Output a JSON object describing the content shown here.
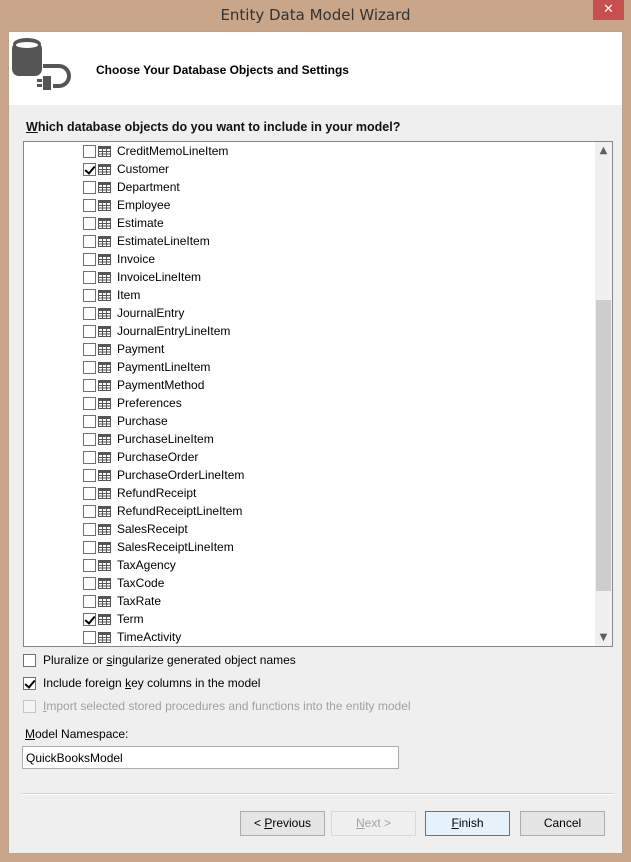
{
  "window": {
    "title": "Entity Data Model Wizard",
    "close_glyph": "✕"
  },
  "header": {
    "icon": "database-plug-icon",
    "title": "Choose Your Database Objects and Settings"
  },
  "question": {
    "mnemonic": "W",
    "rest": "hich database objects do you want to include in your model?"
  },
  "object_list": {
    "item_icon": "table-icon",
    "scroll_position": {
      "thumb_start_fraction": 0.3,
      "thumb_end_fraction": 0.92
    },
    "items": [
      {
        "label": "CreditMemoLineItem",
        "checked": false
      },
      {
        "label": "Customer",
        "checked": true
      },
      {
        "label": "Department",
        "checked": false
      },
      {
        "label": "Employee",
        "checked": false
      },
      {
        "label": "Estimate",
        "checked": false
      },
      {
        "label": "EstimateLineItem",
        "checked": false
      },
      {
        "label": "Invoice",
        "checked": false
      },
      {
        "label": "InvoiceLineItem",
        "checked": false
      },
      {
        "label": "Item",
        "checked": false
      },
      {
        "label": "JournalEntry",
        "checked": false
      },
      {
        "label": "JournalEntryLineItem",
        "checked": false
      },
      {
        "label": "Payment",
        "checked": false
      },
      {
        "label": "PaymentLineItem",
        "checked": false
      },
      {
        "label": "PaymentMethod",
        "checked": false
      },
      {
        "label": "Preferences",
        "checked": false
      },
      {
        "label": "Purchase",
        "checked": false
      },
      {
        "label": "PurchaseLineItem",
        "checked": false
      },
      {
        "label": "PurchaseOrder",
        "checked": false
      },
      {
        "label": "PurchaseOrderLineItem",
        "checked": false
      },
      {
        "label": "RefundReceipt",
        "checked": false
      },
      {
        "label": "RefundReceiptLineItem",
        "checked": false
      },
      {
        "label": "SalesReceipt",
        "checked": false
      },
      {
        "label": "SalesReceiptLineItem",
        "checked": false
      },
      {
        "label": "TaxAgency",
        "checked": false
      },
      {
        "label": "TaxCode",
        "checked": false
      },
      {
        "label": "TaxRate",
        "checked": false
      },
      {
        "label": "Term",
        "checked": true
      },
      {
        "label": "TimeActivity",
        "checked": false
      }
    ]
  },
  "options": {
    "pluralize": {
      "pre": "Pluralize or ",
      "mnemonic": "s",
      "post": "ingularize generated object names",
      "checked": false,
      "enabled": true
    },
    "foreign_keys": {
      "pre": "Include foreign ",
      "mnemonic": "k",
      "post": "ey columns in the model",
      "checked": true,
      "enabled": true
    },
    "stored_procs": {
      "pre": "",
      "mnemonic": "I",
      "post": "mport selected stored procedures and functions into the entity model",
      "checked": false,
      "enabled": false
    }
  },
  "namespace": {
    "label_mnemonic": "M",
    "label_rest": "odel Namespace:",
    "value": "QuickBooksModel"
  },
  "buttons": {
    "previous": {
      "pre": "< ",
      "mnemonic": "P",
      "post": "revious",
      "enabled": true
    },
    "next": {
      "pre": "",
      "mnemonic": "N",
      "post": "ext >",
      "enabled": false
    },
    "finish": {
      "pre": "",
      "mnemonic": "F",
      "post": "inish",
      "enabled": true
    },
    "cancel": {
      "label": "Cancel",
      "enabled": true
    }
  }
}
